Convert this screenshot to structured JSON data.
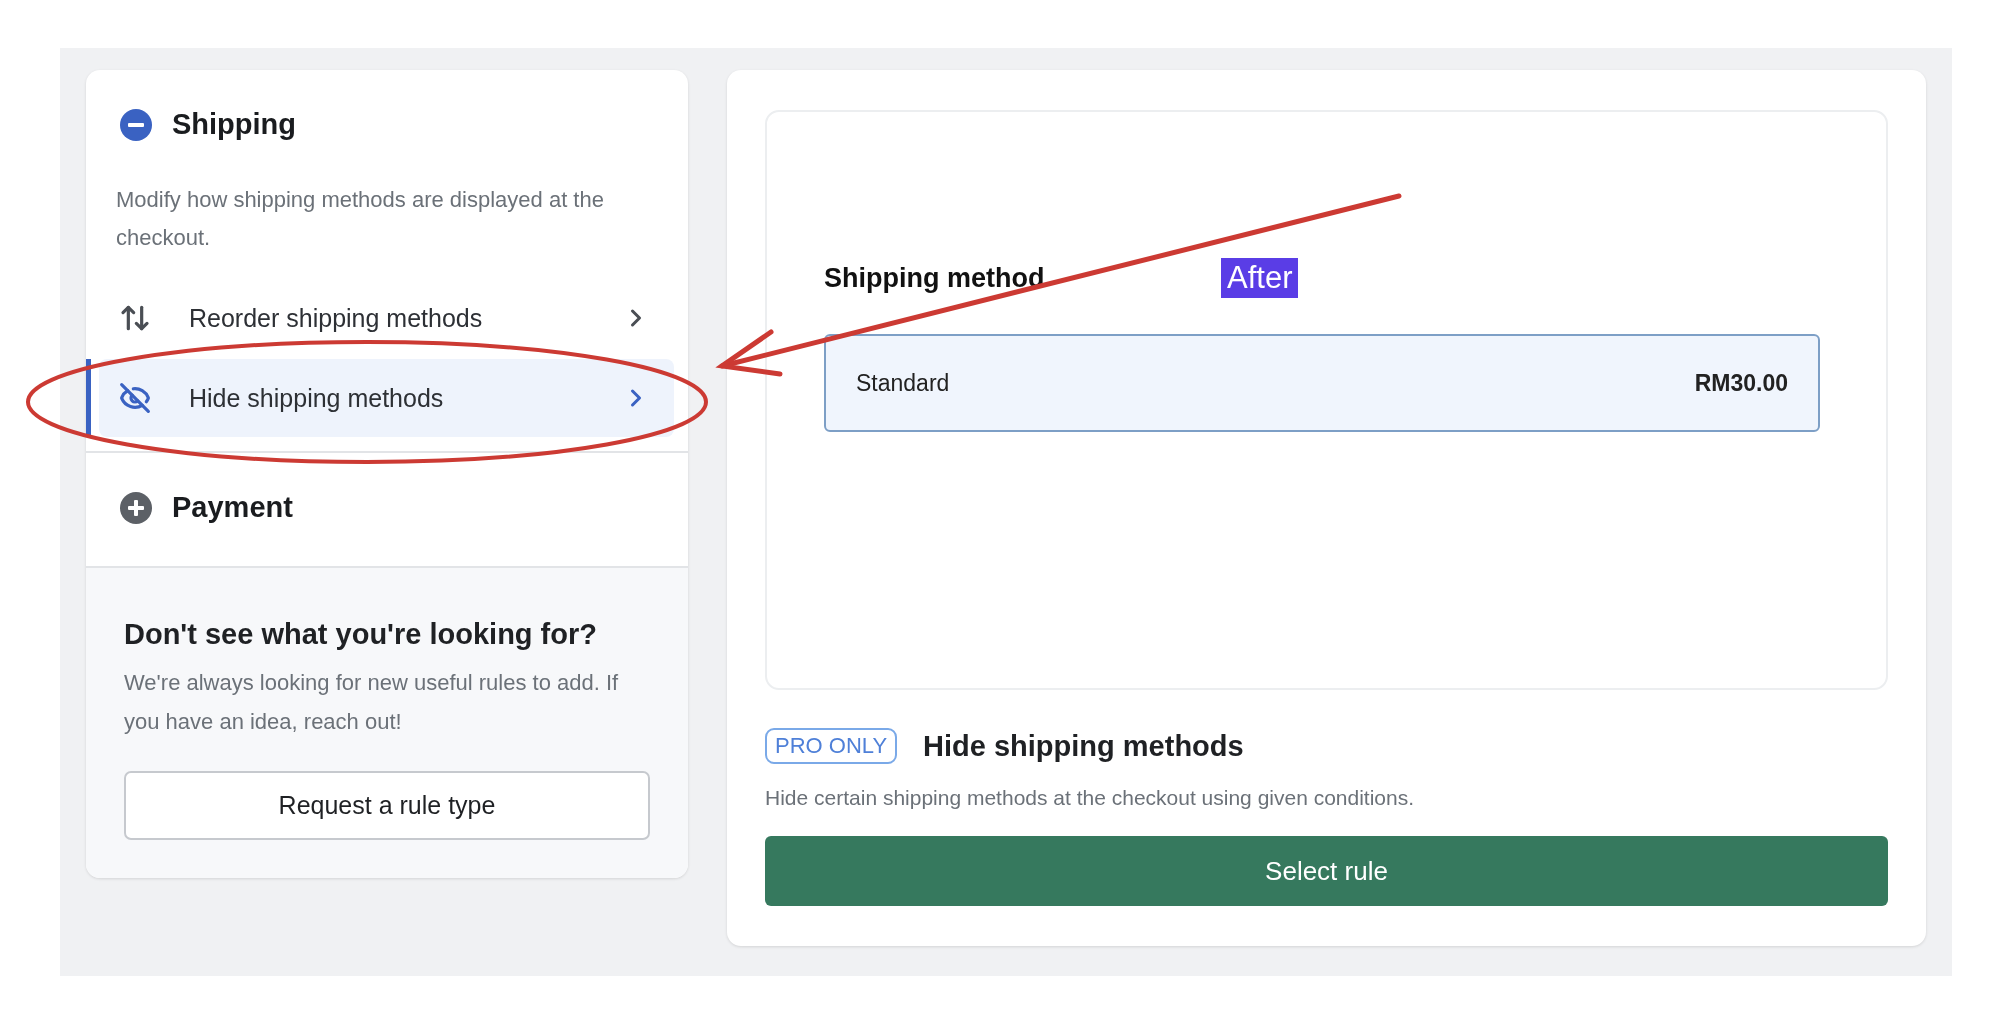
{
  "sidebar": {
    "sections": [
      {
        "title": "Shipping",
        "expanded": true,
        "description": "Modify how shipping methods are displayed at the checkout.",
        "items": [
          {
            "kind": "reorder",
            "label": "Reorder shipping methods",
            "selected": false
          },
          {
            "kind": "hide",
            "label": "Hide shipping methods",
            "selected": true
          }
        ]
      },
      {
        "title": "Payment",
        "expanded": false
      }
    ],
    "help": {
      "heading": "Don't see what you're looking for?",
      "text": "We're always looking for new useful rules to add. If you have an idea, reach out!",
      "button": "Request a rule type"
    }
  },
  "preview": {
    "label": "Shipping method",
    "badge": "After",
    "option": {
      "name": "Standard",
      "price": "RM30.00"
    }
  },
  "rule": {
    "badge": "PRO ONLY",
    "title": "Hide shipping methods",
    "description": "Hide certain shipping methods at the checkout using given conditions.",
    "button": "Select rule"
  }
}
